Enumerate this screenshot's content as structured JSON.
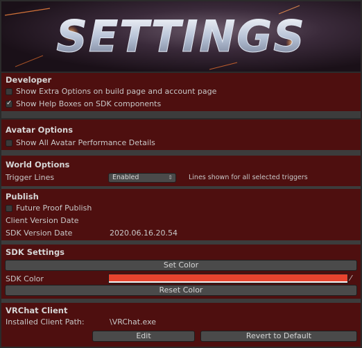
{
  "banner": {
    "title": "SETTINGS"
  },
  "developer": {
    "header": "Developer",
    "options": [
      {
        "label": "Show Extra Options on build page and account page",
        "checked": false
      },
      {
        "label": "Show Help Boxes on SDK components",
        "checked": true
      }
    ]
  },
  "avatar_options": {
    "header": "Avatar Options",
    "options": [
      {
        "label": "Show All Avatar Performance Details",
        "checked": false
      }
    ]
  },
  "world_options": {
    "header": "World Options",
    "trigger_label": "Trigger Lines",
    "trigger_value": "Enabled",
    "trigger_hint": "Lines shown for all selected triggers"
  },
  "publish": {
    "header": "Publish",
    "future_proof_label": "Future Proof Publish",
    "future_proof_checked": false,
    "client_version_label": "Client Version Date",
    "client_version_value": "",
    "sdk_version_label": "SDK Version Date",
    "sdk_version_value": "2020.06.16.20.54"
  },
  "sdk_settings": {
    "header": "SDK Settings",
    "set_color_button": "Set Color",
    "sdk_color_label": "SDK Color",
    "sdk_color_value": "#e8432e",
    "reset_color_button": "Reset Color"
  },
  "vrchat_client": {
    "header": "VRChat Client",
    "path_label": "Installed Client Path:",
    "path_value": "\\VRChat.exe",
    "edit_button": "Edit",
    "revert_button": "Revert to Default"
  },
  "colors": {
    "panel_bg": "#4e0f0f",
    "separator": "#3c3c3c",
    "accent": "#e8432e"
  }
}
